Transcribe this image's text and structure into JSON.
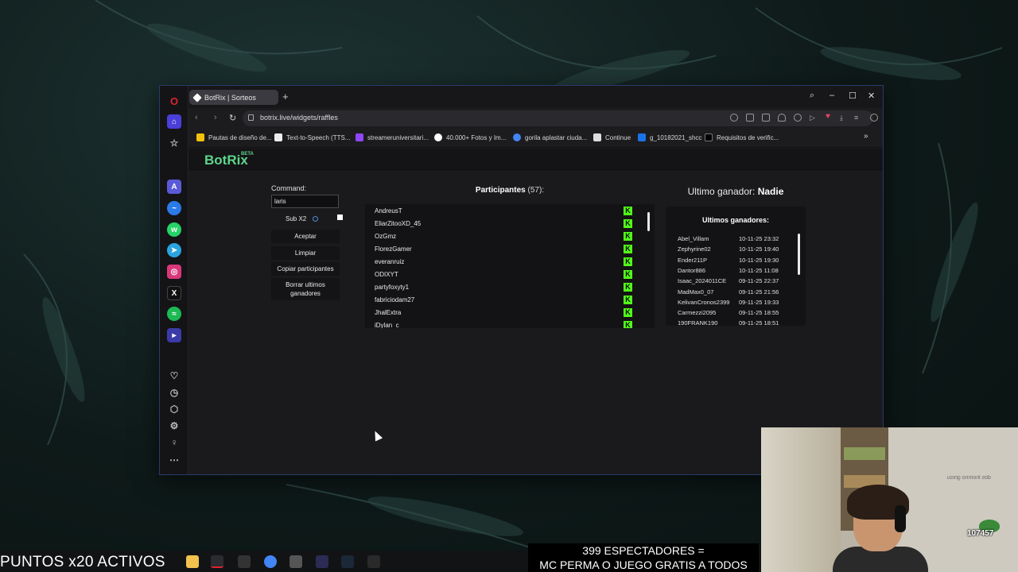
{
  "browser": {
    "tab_title": "BotRix | Sorteos",
    "url": "botrix.live/widgets/raffles",
    "bookmarks": [
      {
        "label": "Pautas de diseño de...",
        "icon": "document-icon"
      },
      {
        "label": "Text-to-Speech (TTS...",
        "icon": "tts-icon"
      },
      {
        "label": "streameruniversitari...",
        "icon": "twitch-icon"
      },
      {
        "label": "40.000+ Fotos y Im...",
        "icon": "photo-icon"
      },
      {
        "label": "gorila aplastar ciuda...",
        "icon": "google-icon"
      },
      {
        "label": "Continue",
        "icon": "document-icon"
      },
      {
        "label": "g_10182021_shcc",
        "icon": "drive-icon"
      },
      {
        "label": "Requisitos de verific...",
        "icon": "x-icon"
      }
    ],
    "bookmarks_more": "»"
  },
  "site": {
    "logo": "BotRix",
    "logo_badge": "BETA"
  },
  "controls": {
    "command_label": "Command:",
    "command_value": "laris",
    "subx2_label": "Sub X2",
    "subx2_checked": true,
    "accept_label": "Aceptar",
    "clear_label": "Limpiar",
    "copy_label": "Copiar participantes",
    "delete_label": "Borrar ultimos ganadores"
  },
  "participants": {
    "title": "Participantes",
    "count": "(57):",
    "platform_icon": "kick-icon",
    "platform_color": "#53fc18",
    "rows": [
      "AndreusT",
      "EliarZitooXD_45",
      "OzGmz",
      "FlorezGamer",
      "everanruiz",
      "ODIXYT",
      "partyfoxyty1",
      "fabriciodam27",
      "JhalExtra",
      "iDylan_c"
    ]
  },
  "winners": {
    "last_winner_label": "Ultimo ganador:",
    "last_winner_name": "Nadie",
    "list_title": "Ultimos ganadores:",
    "rows": [
      {
        "name": "Abel_Villam",
        "date": "10-11-25 23:32"
      },
      {
        "name": "Zephyrine02",
        "date": "10-11-25 19:40"
      },
      {
        "name": "Ender211P",
        "date": "10-11-25 19:30"
      },
      {
        "name": "Dantor886",
        "date": "10-11-25 11:08"
      },
      {
        "name": "Isaac_2024011CE",
        "date": "09-11-25 22:37"
      },
      {
        "name": "MadMax0_07",
        "date": "09-11-25 21:56"
      },
      {
        "name": "KelivanCronos2399",
        "date": "09-11-25 19:33"
      },
      {
        "name": "Carmezzi2095",
        "date": "09-11-25 18:55"
      },
      {
        "name": "190FRANK190",
        "date": "09-11-25 18:51"
      }
    ]
  },
  "overlay": {
    "points_text": "PUNTOS x20 ACTIVOS",
    "viewers_line1": "399 ESPECTADORES =",
    "viewers_line2": "MC PERMA O JUEGO GRATIS A TODOS",
    "webcam_mirrored_text": "dos lnomno gnisu",
    "webcam_count": "107457"
  },
  "colors": {
    "brand": "#5dd58a",
    "kick": "#53fc18",
    "opera_red": "#e0232d"
  }
}
